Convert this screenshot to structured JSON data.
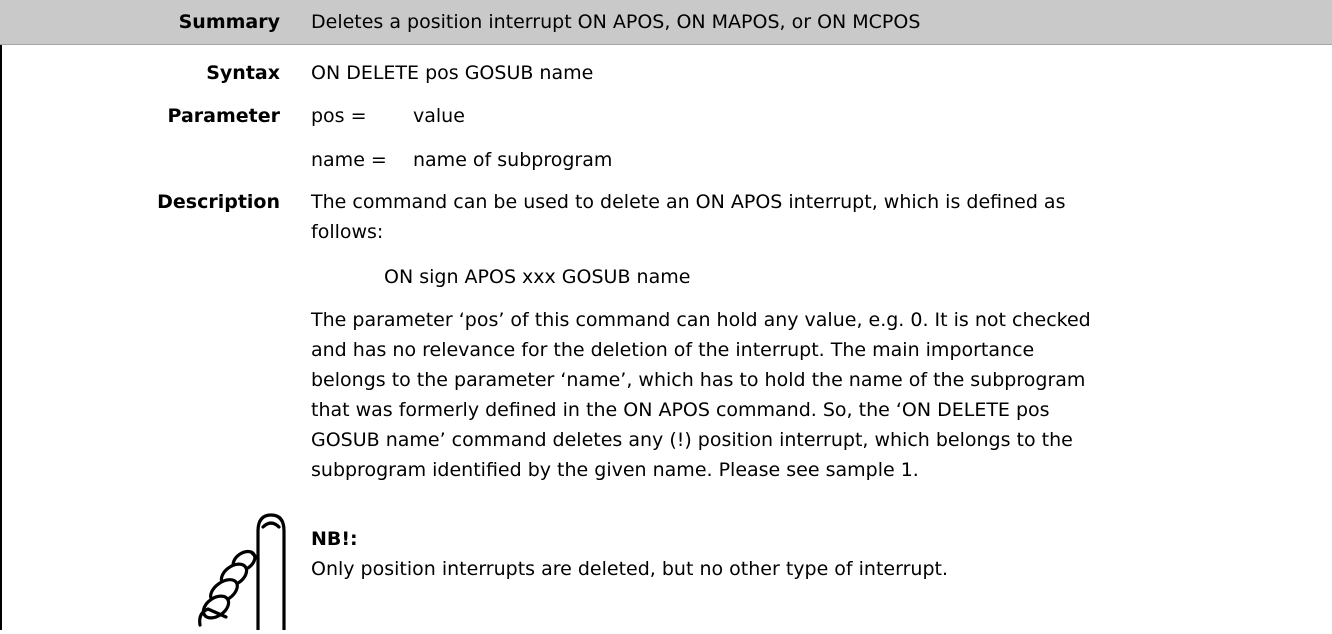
{
  "summary": {
    "label": "Summary",
    "text": "Deletes a position interrupt ON APOS, ON MAPOS, or ON MCPOS"
  },
  "syntax": {
    "label": "Syntax",
    "text": "ON DELETE pos GOSUB name"
  },
  "parameter": {
    "label": "Parameter",
    "rows": [
      {
        "name": "pos =",
        "value": "value"
      },
      {
        "name": "name =",
        "value": "name of subprogram"
      }
    ]
  },
  "description": {
    "label": "Description",
    "intro_line1": "The command can be used to delete an ON APOS interrupt, which is defined as",
    "intro_line2": "follows:",
    "code": "ON sign APOS xxx GOSUB name",
    "body_lines": [
      "The parameter ‘pos’ of this command can hold any value, e.g. 0. It is not checked",
      "and has no relevance for the deletion of the interrupt. The main importance",
      "belongs to the parameter ‘name’, which has to hold the name of the subprogram",
      "that was formerly defined in the ON APOS command. So, the ‘ON DELETE pos",
      "GOSUB name’ command deletes any (!) position interrupt, which belongs to the",
      "subprogram identified by the given name. Please see sample 1."
    ]
  },
  "note": {
    "title": "NB!:",
    "text": "Only position interrupts are deleted, but no other type of interrupt.",
    "icon": "pointing-hand-icon"
  }
}
